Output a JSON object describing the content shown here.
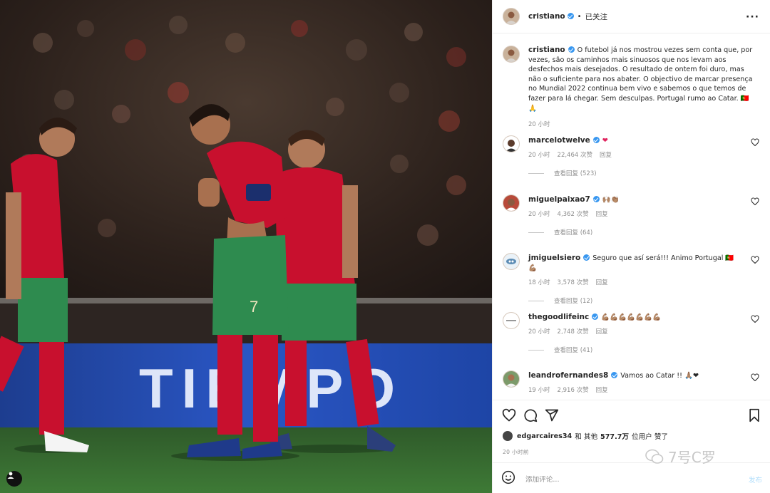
{
  "post": {
    "author": "cristiano",
    "follow_status": "已关注",
    "caption": "O futebol já nos mostrou vezes sem conta que, por vezes, são os caminhos mais sinuosos que nos levam aos desfechos mais desejados. O resultado de ontem foi duro, mas não o suficiente para nos abater. O objectivo de marcar presença no Mundial 2022 continua bem vivo e sabemos o que temos de fazer para lá chegar. Sem desculpas. Portugal rumo ao Catar. 🇵🇹🙏",
    "caption_time": "20 小时",
    "photo_ad_board_text": "TIEMPO"
  },
  "comments": [
    {
      "user": "marcelotwelve",
      "text": "❤",
      "time": "20 小时",
      "likes": "22,464 次赞",
      "reply": "回复",
      "view_replies": "查看回复 (523)"
    },
    {
      "user": "miguelpaixao7",
      "text": "🙌🏽👏🏽",
      "time": "20 小时",
      "likes": "4,362 次赞",
      "reply": "回复",
      "view_replies": "查看回复 (64)"
    },
    {
      "user": "jmiguelsiero",
      "text": "Seguro que así será!!! Animo Portugal 🇵🇹💪🏽",
      "time": "18 小时",
      "likes": "3,578 次赞",
      "reply": "回复",
      "view_replies": "查看回复 (12)"
    },
    {
      "user": "thegoodlifeinc",
      "text": "💪🏽💪🏽💪🏽💪🏽💪🏽💪🏽💪🏽",
      "time": "20 小时",
      "likes": "2,748 次赞",
      "reply": "回复",
      "view_replies": "查看回复 (41)"
    },
    {
      "user": "leandrofernandes8",
      "text": "Vamos ao Catar !! 🙏🏽❤",
      "time": "19 小时",
      "likes": "2,916 次赞",
      "reply": "回复",
      "view_replies": ""
    }
  ],
  "likes": {
    "first_user": "edgarcaires34",
    "connector": "和 其他",
    "count": "577.7万",
    "suffix": "位用户 赞了"
  },
  "post_time": "20 小时前",
  "add_comment": {
    "placeholder": "添加评论...",
    "post_label": "发布"
  },
  "watermark": "7号C罗",
  "icons": [
    "more-icon",
    "heart-icon",
    "comment-icon",
    "share-icon",
    "bookmark-icon",
    "emoji-icon",
    "verified-icon",
    "user-tag-icon"
  ],
  "colors": {
    "verified": "#3897f0",
    "muted": "#8e8e8e",
    "post_disabled": "#b2dffc",
    "jersey_red": "#c8102e",
    "shorts_green": "#2e8b4f"
  }
}
